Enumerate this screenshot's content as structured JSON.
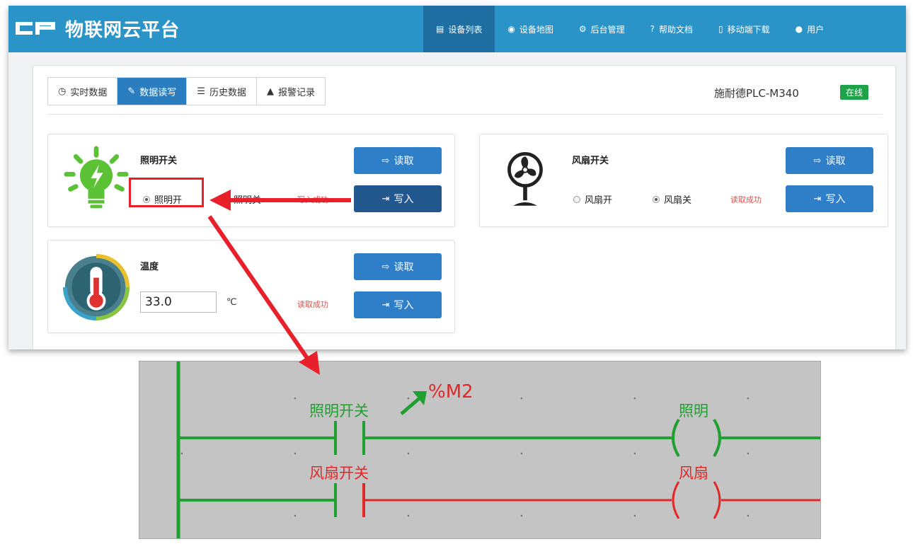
{
  "header": {
    "logo_mark": "CP",
    "logo_text": "物联网云平台",
    "nav": [
      {
        "icon": "▤",
        "label": "设备列表",
        "active": true
      },
      {
        "icon": "◉",
        "label": "设备地图"
      },
      {
        "icon": "⚙",
        "label": "后台管理"
      },
      {
        "icon": "?",
        "label": "帮助文档"
      },
      {
        "icon": "▯",
        "label": "移动端下载"
      },
      {
        "icon": "●",
        "label": "用户"
      }
    ]
  },
  "tabs": [
    {
      "icon": "◷",
      "label": "实时数据"
    },
    {
      "icon": "✎",
      "label": "数据读写",
      "active": true
    },
    {
      "icon": "☰",
      "label": "历史数据"
    },
    {
      "icon": "▲",
      "label": "报警记录"
    }
  ],
  "device": {
    "name": "施耐德PLC-M340",
    "status": "在线"
  },
  "panels": {
    "light": {
      "title": "照明开关",
      "option_on": "照明开",
      "option_off": "照明关",
      "selected": "on",
      "status": "写入成功",
      "read_label": "读取",
      "write_label": "写入"
    },
    "fan": {
      "title": "风扇开关",
      "option_on": "风扇开",
      "option_off": "风扇关",
      "selected": "off",
      "status": "读取成功",
      "read_label": "读取",
      "write_label": "写入"
    },
    "temp": {
      "title": "温度",
      "value": "33.0",
      "unit": "℃",
      "status": "读取成功",
      "read_label": "读取",
      "write_label": "写入"
    }
  },
  "ladder": {
    "contact1": "照明开关",
    "address1": "%M2",
    "coil1": "照明",
    "contact2": "风扇开关",
    "coil2": "风扇"
  },
  "colors": {
    "header": "#2a93c8",
    "button": "#2f7fc8",
    "online": "#1fa34a",
    "annotation": "#e8202a",
    "ladder_on": "#20a030",
    "ladder_off": "#e02828"
  }
}
